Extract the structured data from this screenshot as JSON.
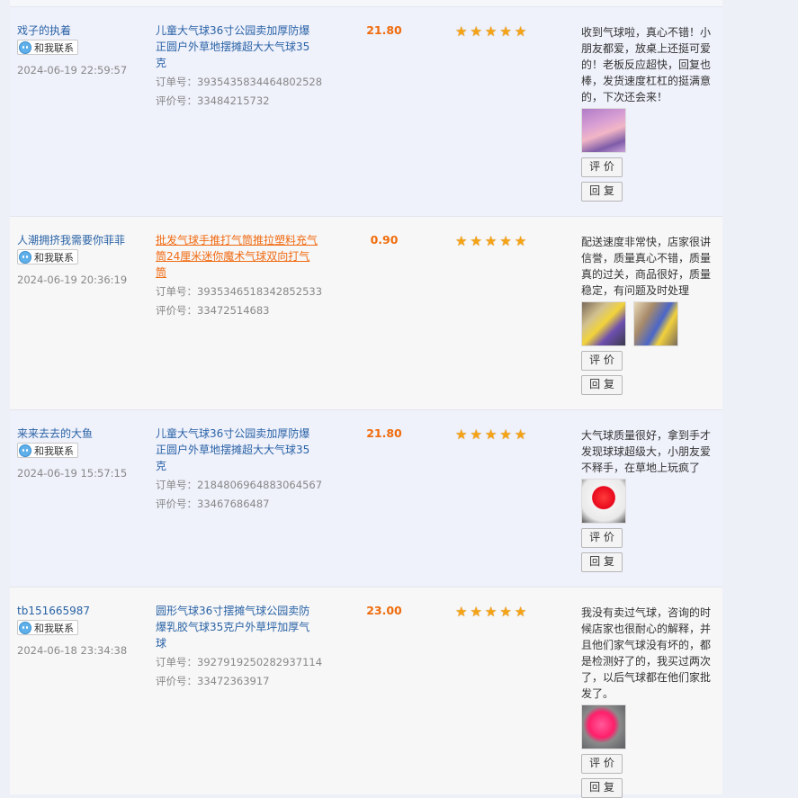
{
  "labels": {
    "contact": "和我联系",
    "order_prefix": "订单号：",
    "rating_prefix": "评价号：",
    "rate_button": "评 价",
    "reply_button": "回 复"
  },
  "reviews": [
    {
      "buyer": "戏子的执着",
      "time": "2024-06-19 22:59:57",
      "product": "儿童大气球36寸公园卖加厚防爆正圆户外草地摆摊超大大气球35克",
      "product_highlight": false,
      "order_no": "3935435834464802528",
      "rating_no": "33484215732",
      "price": "21.80",
      "stars": 5,
      "text": "收到气球啦，真心不错！小朋友都爱，放桌上还挺可爱的！老板反应超快，回复也棒，发货速度杠杠的挺满意的，下次还会来！",
      "photos": [
        "balloons-purple-pink"
      ]
    },
    {
      "buyer": "人潮拥挤我需要你菲菲",
      "time": "2024-06-19 20:36:19",
      "product": "批发气球手推打气筒推拉塑料充气筒24厘米迷你魔术气球双向打气筒",
      "product_highlight": true,
      "order_no": "3935346518342852533",
      "rating_no": "33472514683",
      "price": "0.90",
      "stars": 5,
      "text": "配送速度非常快，店家很讲信誉，质量真心不错，质量真的过关，商品很好，质量稳定，有问题及时处理",
      "photos": [
        "pump-photo-1",
        "pump-photo-2"
      ]
    },
    {
      "buyer": "来来去去的大鱼",
      "time": "2024-06-19 15:57:15",
      "product": "儿童大气球36寸公园卖加厚防爆正圆户外草地摆摊超大大气球35克",
      "product_highlight": false,
      "order_no": "2184806964883064567",
      "rating_no": "33467686487",
      "price": "21.80",
      "stars": 5,
      "text": "大气球质量很好，拿到手才发现球球超级大，小朋友爱不释手，在草地上玩疯了",
      "photos": [
        "red-balloon"
      ]
    },
    {
      "buyer": "tb151665987",
      "time": "2024-06-18 23:34:38",
      "product": "圆形气球36寸摆摊气球公园卖防爆乳胶气球35克户外草坪加厚气球",
      "product_highlight": false,
      "order_no": "3927919250282937114",
      "rating_no": "33472363917",
      "price": "23.00",
      "stars": 5,
      "text": "我没有卖过气球，咨询的时候店家也很耐心的解释，并且他们家气球没有坏的，都是检测好了的，我买过两次了，以后气球都在他们家批发了。",
      "photos": [
        "pink-balloon"
      ]
    }
  ]
}
